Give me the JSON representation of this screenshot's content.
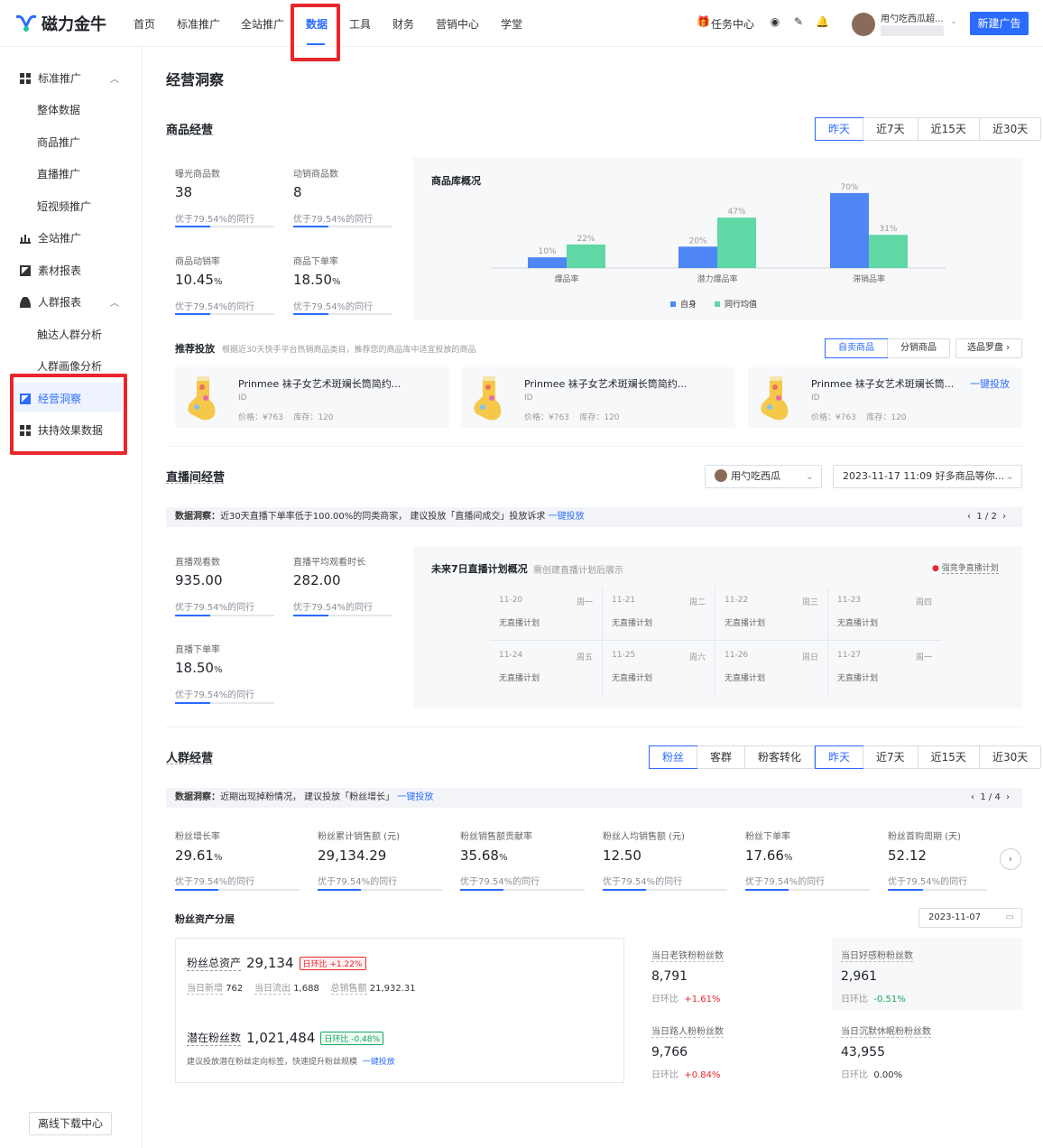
{
  "app": {
    "logo_text": "磁力金牛",
    "brand_color": "#2b6cff"
  },
  "topnav": {
    "items": [
      "首页",
      "标准推广",
      "全站推广",
      "数据",
      "工具",
      "财务",
      "营销中心",
      "学堂"
    ],
    "active": "数据",
    "task_center": "任务中心",
    "user_name": "用勺吃西瓜超...",
    "new_ad": "新建广告"
  },
  "sidebar": {
    "groups": [
      {
        "label": "标准推广",
        "children": [
          "整体数据",
          "商品推广",
          "直播推广",
          "短视频推广"
        ]
      },
      {
        "label": "全站推广"
      },
      {
        "label": "素材报表"
      },
      {
        "label": "人群报表",
        "children": [
          "触达人群分析",
          "人群画像分析"
        ]
      },
      {
        "label": "经营洞察",
        "active": true
      },
      {
        "label": "扶持效果数据"
      }
    ],
    "offline_download": "离线下载中心"
  },
  "page_title": "经营洞察",
  "goods": {
    "title": "商品经营",
    "ranges": [
      "昨天",
      "近7天",
      "近15天",
      "近30天"
    ],
    "active_range": "昨天",
    "metrics": [
      {
        "label": "曝光商品数",
        "value": "38",
        "unit": "",
        "compare": "优于79.54%的同行"
      },
      {
        "label": "动销商品数",
        "value": "8",
        "unit": "",
        "compare": "优于79.54%的同行"
      },
      {
        "label": "商品动销率",
        "value": "10.45",
        "unit": "%",
        "compare": "优于79.54%的同行"
      },
      {
        "label": "商品下单率",
        "value": "18.50",
        "unit": "%",
        "compare": "优于79.54%的同行"
      }
    ],
    "chart_title": "商品库概况",
    "legend": [
      "自身",
      "同行均值"
    ]
  },
  "chart_data": {
    "type": "bar",
    "title": "商品库概况",
    "categories": [
      "爆品率",
      "潜力爆品率",
      "滞销品率"
    ],
    "series": [
      {
        "name": "自身",
        "values": [
          10,
          20,
          70
        ],
        "color": "#4e86f5"
      },
      {
        "name": "同行均值",
        "values": [
          22,
          47,
          31
        ],
        "color": "#5fd8a5"
      }
    ],
    "ylim": [
      0,
      80
    ],
    "grid": false,
    "legend_position": "bottom"
  },
  "recommend": {
    "title": "推荐投放",
    "desc": "根据近30天快手平台热销商品类目，推荐您的商品库中适宜投放的商品",
    "tabs": [
      "自卖商品",
      "分销商品"
    ],
    "active_tab": "自卖商品",
    "selector": "选品罗盘",
    "action": "一键投放",
    "products": [
      {
        "title": "Prinmee 袜子女艺术斑斓长筒简约...",
        "id": "ID",
        "price": "价格：¥763",
        "stock": "库存：120"
      },
      {
        "title": "Prinmee 袜子女艺术斑斓长筒简约...",
        "id": "ID",
        "price": "价格：¥763",
        "stock": "库存：120"
      },
      {
        "title": "Prinmee 袜子女艺术斑斓长筒...",
        "id": "ID",
        "price": "价格：¥763",
        "stock": "库存：120"
      }
    ]
  },
  "live": {
    "title": "直播间经营",
    "account": "用勺吃西瓜",
    "session": "2023-11-17 11:09 好多商品等你...",
    "insight_label": "数据洞察：",
    "insight": "近30天直播下单率低于100.00%的同类商家，  建议投放「直播间成交」投放诉求",
    "insight_link": "一键投放",
    "pager": "1 / 2",
    "metrics": [
      {
        "label": "直播观看数",
        "value": "935.00",
        "unit": "",
        "compare": "优于79.54%的同行"
      },
      {
        "label": "直播平均观看时长",
        "value": "282.00",
        "unit": "",
        "compare": "优于79.54%的同行"
      },
      {
        "label": "直播下单率",
        "value": "18.50",
        "unit": "%",
        "compare": "优于79.54%的同行"
      }
    ],
    "plan_title": "未来7日直播计划概况",
    "plan_sub": "需创建直播计划后展示",
    "plan_link": "强竞争直播计划",
    "days": [
      {
        "date": "11-20",
        "week": "周一",
        "text": "无直播计划"
      },
      {
        "date": "11-21",
        "week": "周二",
        "text": "无直播计划"
      },
      {
        "date": "11-22",
        "week": "周三",
        "text": "无直播计划"
      },
      {
        "date": "11-23",
        "week": "周四",
        "text": "无直播计划"
      },
      {
        "date": "11-24",
        "week": "周五",
        "text": "无直播计划"
      },
      {
        "date": "11-25",
        "week": "周六",
        "text": "无直播计划"
      },
      {
        "date": "11-26",
        "week": "周日",
        "text": "无直播计划"
      },
      {
        "date": "11-27",
        "week": "周一",
        "text": "无直播计划"
      }
    ]
  },
  "crowd": {
    "title": "人群经营",
    "types": [
      "粉丝",
      "客群",
      "粉客转化"
    ],
    "active_type": "粉丝",
    "ranges": [
      "昨天",
      "近7天",
      "近15天",
      "近30天"
    ],
    "active_range": "昨天",
    "insight_label": "数据洞察：",
    "insight": "近期出现掉粉情况，  建议投放「粉丝增长」",
    "insight_link": "一键投放",
    "pager": "1 / 4",
    "metrics": [
      {
        "label": "粉丝增长率",
        "value": "29.61",
        "unit": "%",
        "compare": "优于79.54%的同行"
      },
      {
        "label": "粉丝累计销售额 (元)",
        "value": "29,134.29",
        "unit": "",
        "compare": "优于79.54%的同行"
      },
      {
        "label": "粉丝销售额贡献率",
        "value": "35.68",
        "unit": "%",
        "compare": "优于79.54%的同行"
      },
      {
        "label": "粉丝人均销售额 (元)",
        "value": "12.50",
        "unit": "",
        "compare": "优于79.54%的同行"
      },
      {
        "label": "粉丝下单率",
        "value": "17.66",
        "unit": "%",
        "compare": "优于79.54%的同行"
      },
      {
        "label": "粉丝首购周期 (天)",
        "value": "52.12",
        "unit": "",
        "compare": "优于79.54%的同行"
      }
    ],
    "asset_title": "粉丝资产分层",
    "date": "2023-11-07",
    "total_label": "粉丝总资产",
    "total_value": "29,134",
    "total_badge": "日环比 +1.22%",
    "new_label": "当日新增",
    "new_value": "762",
    "out_label": "当日流出",
    "out_value": "1,688",
    "sales_label": "总销售额",
    "sales_value": "21,932.31",
    "potential_label": "潜在粉丝数",
    "potential_value": "1,021,484",
    "potential_badge": "日环比 -0.48%",
    "potential_desc": "建议投放潜在粉丝定向标签，快速提升粉丝规模",
    "potential_link": "一键投放",
    "layers": [
      {
        "label": "当日老铁粉粉丝数",
        "value": "8,791",
        "ratio_label": "日环比",
        "ratio": "+1.61%",
        "trend": "up"
      },
      {
        "label": "当日好感粉粉丝数",
        "value": "2,961",
        "ratio_label": "日环比",
        "ratio": "-0.51%",
        "trend": "down"
      },
      {
        "label": "当日路人粉粉丝数",
        "value": "9,766",
        "ratio_label": "日环比",
        "ratio": "+0.84%",
        "trend": "up"
      },
      {
        "label": "当日沉默休眠粉粉丝数",
        "value": "43,955",
        "ratio_label": "日环比",
        "ratio": "0.00%",
        "trend": "flat"
      }
    ]
  }
}
